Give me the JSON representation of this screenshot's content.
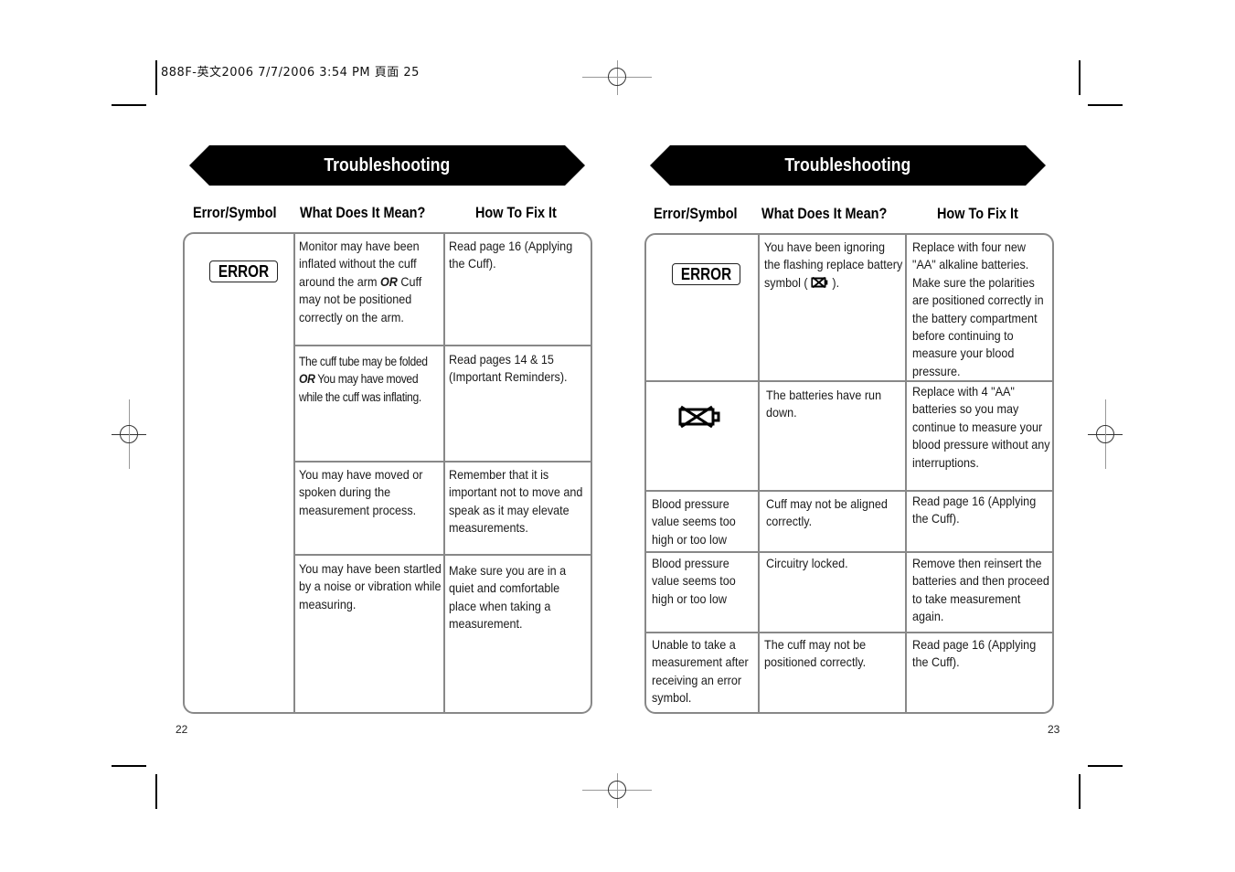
{
  "slug": "888F-英文2006  7/7/2006  3:54 PM  頁面 25",
  "left_page": {
    "title": "Troubleshooting",
    "columns": [
      "Error/Symbol",
      "What Does It Mean?",
      "How To Fix It"
    ],
    "symbol": {
      "icon": "error-display-icon",
      "label": "ERROR"
    },
    "rows": [
      {
        "meaning_pre": "Monitor may have been inflated without the cuff around the arm ",
        "meaning_or": "OR",
        "meaning_post": " Cuff may not be positioned correctly on the arm.",
        "fix": "Read page 16 (Applying the Cuff)."
      },
      {
        "meaning_pre": "The cuff  tube may be folded ",
        "meaning_or": "OR",
        "meaning_post": " You may have moved while the cuff was inflating.",
        "fix": "Read pages 14 & 15 (Important Reminders)."
      },
      {
        "meaning": "You may have moved or spoken during the measurement process.",
        "fix": "Remember that it is important not to move and speak as it may elevate measurements."
      },
      {
        "meaning": "You may have been startled by a noise or vibration while measuring.",
        "fix": "Make sure you are in a quiet and comfortable place when taking a measurement."
      }
    ],
    "page_number": "22"
  },
  "right_page": {
    "title": "Troubleshooting",
    "columns": [
      "Error/Symbol",
      "What Does It Mean?",
      "How To Fix It"
    ],
    "rows": [
      {
        "symbol_label": "ERROR",
        "symbol_icon": "error-display-icon",
        "meaning_pre": "You have been ignoring the flashing replace battery symbol ( ",
        "meaning_icon": "low-battery-icon",
        "meaning_post": " ).",
        "fix": "Replace with four new \"AA\" alkaline batteries. Make sure the polarities are positioned correctly in the battery compartment before continuing to measure your blood pressure."
      },
      {
        "symbol_icon": "low-battery-icon",
        "meaning": "The batteries have run down.",
        "fix": "Replace with 4 \"AA\" batteries so you may continue to measure your blood pressure without any interruptions."
      },
      {
        "symbol": "Blood pressure value seems too high or too low",
        "meaning": "Cuff may not be aligned correctly.",
        "fix": "Read page 16 (Applying the Cuff)."
      },
      {
        "symbol": "Blood pressure value seems too high or too low",
        "meaning": "Circuitry locked.",
        "fix": "Remove then reinsert the batteries and then proceed to take measurement again."
      },
      {
        "symbol": "Unable to take a measurement after receiving an error symbol.",
        "meaning": "The cuff may not be positioned correctly.",
        "fix": "Read page 16 (Applying the Cuff)."
      }
    ],
    "page_number": "23"
  }
}
